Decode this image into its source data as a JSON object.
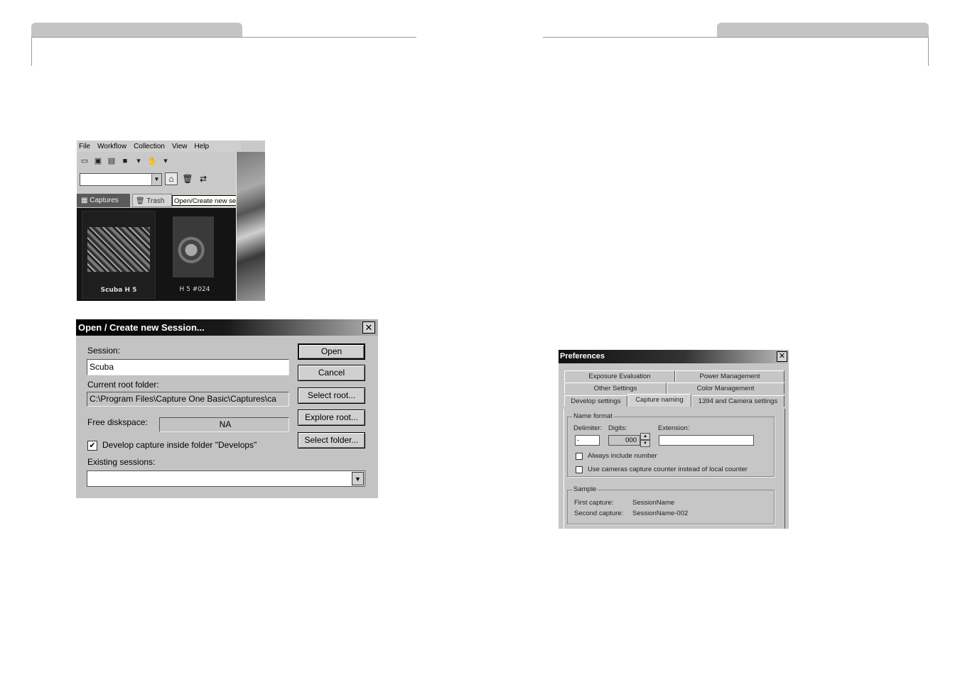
{
  "app": {
    "menu": [
      "File",
      "Workflow",
      "Collection",
      "View",
      "Help"
    ],
    "tabs": {
      "captures": "Captures",
      "trash": "Trash"
    },
    "tooltip": "Open/Create new session",
    "thumbnails": [
      {
        "caption": "Scuba H 5"
      },
      {
        "caption": "H 5 #024"
      }
    ]
  },
  "session_dialog": {
    "title": "Open / Create new Session...",
    "session_label": "Session:",
    "session_value": "Scuba",
    "root_label": "Current root folder:",
    "root_value": "C:\\Program Files\\Capture One Basic\\Captures\\ca",
    "diskspace_label": "Free diskspace:",
    "diskspace_value": "NA",
    "develop_checkbox_label": "Develop capture inside folder \"Develops\"",
    "develop_checked": true,
    "existing_label": "Existing sessions:",
    "existing_value": "",
    "buttons": {
      "open": "Open",
      "cancel": "Cancel",
      "select_root": "Select root...",
      "explore_root": "Explore root...",
      "select_folder": "Select folder..."
    }
  },
  "preferences": {
    "title": "Preferences",
    "tabs_row1": [
      "Exposure Evaluation",
      "Power Management"
    ],
    "tabs_row2": [
      "Other Settings",
      "Color Management"
    ],
    "tabs_row3": [
      "Develop settings",
      "Capture naming",
      "1394 and Camera settings"
    ],
    "active_tab": "Capture naming",
    "name_format": {
      "group_title": "Name format",
      "delimiter_label": "Delimiter:",
      "delimiter_value": "-",
      "digits_label": "Digits:",
      "digits_value": "000",
      "extension_label": "Extension:",
      "extension_value": "",
      "always_include_number": "Always include number",
      "use_camera_counter": "Use cameras capture counter instead of local counter"
    },
    "sample": {
      "group_title": "Sample",
      "first_label": "First capture:",
      "first_value": "SessionName",
      "second_label": "Second capture:",
      "second_value": "SessionName-002"
    }
  }
}
